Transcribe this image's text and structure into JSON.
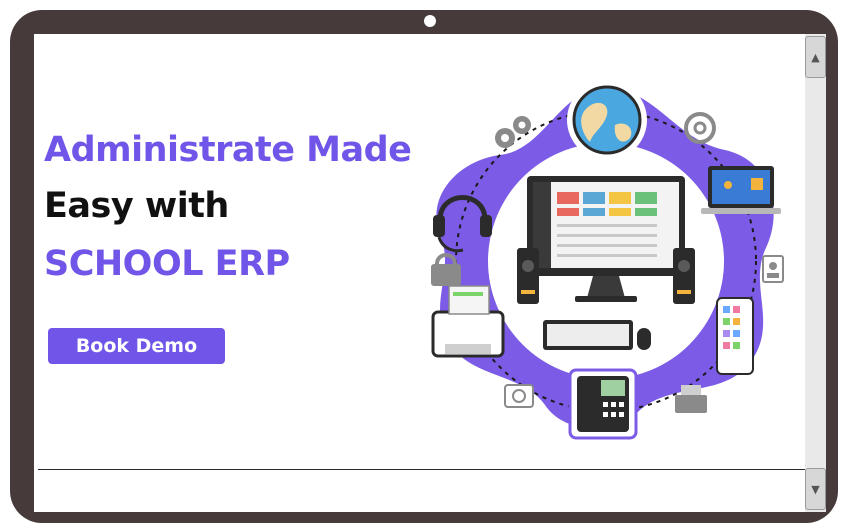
{
  "hero": {
    "headline_line1": "Administrate Made",
    "headline_line2": "Easy with",
    "headline_line3": "SCHOOL ERP",
    "cta_label": "Book Demo"
  },
  "colors": {
    "accent": "#7055e8",
    "bezel": "#463b3a",
    "text_dark": "#111111"
  },
  "icons": [
    "globe-icon",
    "at-sign-icon",
    "gears-icon",
    "laptop-icon",
    "headset-icon",
    "id-badge-icon",
    "padlock-icon",
    "smartphone-icon",
    "printer-icon",
    "desk-phone-icon",
    "scanner-icon",
    "desktop-computer-icon",
    "speaker-icon",
    "keyboard-icon",
    "mouse-icon",
    "monitor-icon"
  ]
}
